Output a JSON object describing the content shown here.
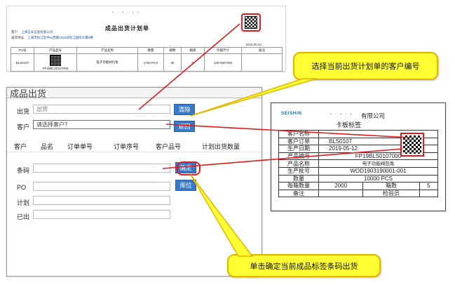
{
  "plan_doc": {
    "title": "成品出货计划单",
    "customer_label": "客户:",
    "customer_value": "上海信长五金有限公司",
    "address_label": "送货地址:",
    "address_value": "上海市松江区中山西路1510号松江国际大厦5楼",
    "date": "2019.05.22",
    "headers": [
      "PO号",
      "产品品号",
      "产品名称",
      "数量",
      "箱数",
      "箱规",
      "外箱尺寸",
      "备注"
    ],
    "row": [
      "BLS0107",
      "FP19BLS0107000",
      "电子功能阀包角",
      "1750 PCS",
      "35",
      "0",
      "100*200*300",
      ""
    ]
  },
  "form": {
    "title": "成品出货",
    "shipment_label": "出货",
    "shipment_placeholder": "出货",
    "clear_button": "清除",
    "customer_label": "客户",
    "customer_placeholder": "请选择客户?",
    "back_button": "返回",
    "columns": [
      "客户",
      "品名",
      "订单单号",
      "订单序号",
      "客户品号",
      "计划出货数量"
    ],
    "barcode_label": "条码",
    "confirm_button": "确定",
    "po_label": "PO",
    "location_button": "库位",
    "plan_label": "计划",
    "shipped_label": "已出"
  },
  "label_card": {
    "logo": "SEISHIN",
    "company": "有限公司",
    "name": "卡板标签",
    "rows": [
      [
        "客户名称",
        ""
      ],
      [
        "客户订单",
        "BLS0107"
      ],
      [
        "生产日期",
        "2019-05-12"
      ],
      [
        "产品编号",
        "FP19BLS0107000"
      ],
      [
        "产品名称",
        "电子功能阀包角"
      ],
      [
        "生产批号",
        "WOD1903190001-001"
      ],
      [
        "数量",
        "10000  PCS"
      ],
      [
        "每箱数量",
        "2000",
        "箱数",
        "5"
      ],
      [
        "备注",
        "",
        "检验员",
        ""
      ]
    ]
  },
  "callouts": {
    "top": "选择当前出货计划单的客户编号",
    "bottom": "单击确定当前成品标签条码出货"
  },
  "colors": {
    "button_blue": "#3a78c9",
    "callout_yellow": "#ffff33",
    "highlight_red": "#e21c1c",
    "logo_blue": "#1c6fb8"
  }
}
